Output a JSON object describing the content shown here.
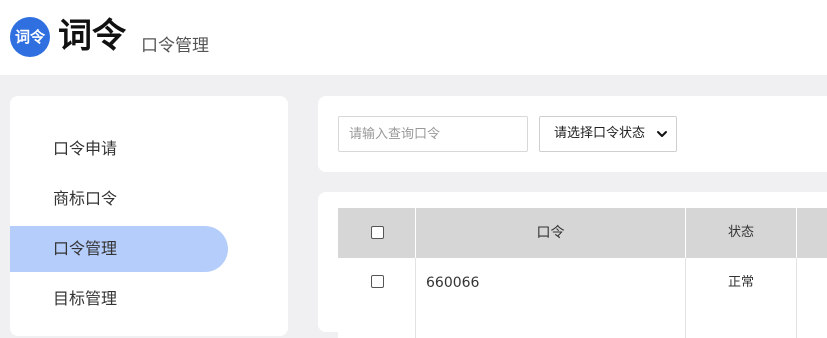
{
  "header": {
    "logo_text": "词令",
    "app_title": "词令",
    "subtitle": "口令管理"
  },
  "sidebar": {
    "items": [
      {
        "label": "口令申请",
        "active": false
      },
      {
        "label": "商标口令",
        "active": false
      },
      {
        "label": "口令管理",
        "active": true
      },
      {
        "label": "目标管理",
        "active": false
      }
    ]
  },
  "filters": {
    "search_placeholder": "请输入查询口令",
    "search_value": "",
    "status_select_value": "请选择口令状态"
  },
  "table": {
    "columns": [
      "口令",
      "状态"
    ],
    "rows": [
      {
        "code": "660066",
        "status": "正常",
        "checked": false
      }
    ]
  },
  "colors": {
    "accent": "#2f6fe0",
    "active_item_bg": "#b5cdfa",
    "page_bg": "#f0f0f2",
    "table_header_bg": "#d6d6d6"
  }
}
